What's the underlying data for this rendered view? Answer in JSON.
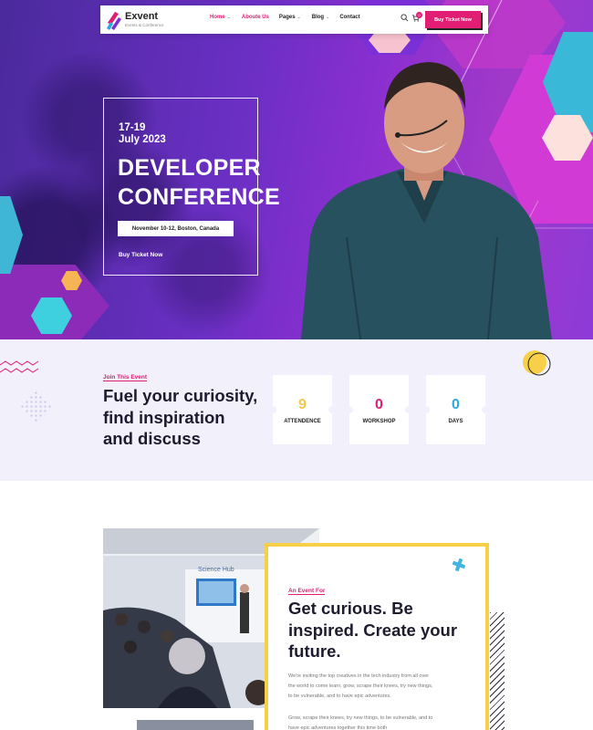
{
  "nav": {
    "logo_name": "Exvent",
    "logo_tagline": "Events & Conference",
    "items": [
      {
        "label": "Home",
        "has_dropdown": true,
        "active": true
      },
      {
        "label": "Aboute Us",
        "has_dropdown": false,
        "active": true
      },
      {
        "label": "Pages",
        "has_dropdown": true,
        "active": false
      },
      {
        "label": "Blog",
        "has_dropdown": true,
        "active": false
      },
      {
        "label": "Contact",
        "has_dropdown": false,
        "active": false
      }
    ],
    "cart_count": "0",
    "cta_label": "Buy Ticket Now",
    "icons": [
      "search-icon",
      "cart-icon",
      "chevron-down-icon"
    ]
  },
  "hero": {
    "date": "17-19\nJuly 2023",
    "title": "DEVELOPER\nCONFERENCE",
    "location": "November 10-12, Boston, Canada",
    "buy_label": "Buy Ticket Now"
  },
  "stats_section": {
    "label": "Join This Event",
    "heading": "Fuel your curiosity,\nfind inspiration\nand discuss",
    "stats": [
      {
        "value": "9",
        "label": "ATTENDENCE",
        "color": "#f2c94c"
      },
      {
        "value": "0",
        "label": "WORKSHOP",
        "color": "#e11d74"
      },
      {
        "value": "0",
        "label": "DAYS",
        "color": "#2ba8e0"
      }
    ]
  },
  "about": {
    "label": "An Event For",
    "heading": "Get curious. Be\ninspired. Create your\nfuture.",
    "paragraph1": "We're inviting the top creatives in the tech industry from all over the world to come learn, grow, scrape their knees, try new things, to be vulnerable, and to have epic adventures.",
    "paragraph2": "Grow, scrape their knees, try new things, to be vulnerable, and to have epic adventures together this time both",
    "image_screen_text": "Science Hub"
  },
  "colors": {
    "accent_pink": "#e11d74",
    "accent_yellow": "#f7cf48",
    "accent_blue": "#2ba8e0",
    "hero_purple": "#7a30c8",
    "stats_bg": "#f1f0fb"
  }
}
